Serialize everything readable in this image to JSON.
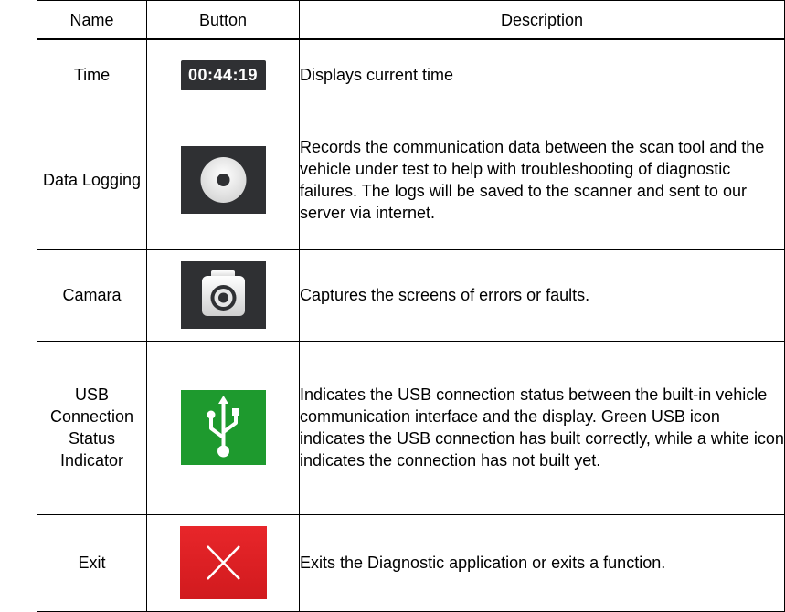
{
  "headers": {
    "name": "Name",
    "button": "Button",
    "description": "Description"
  },
  "rows": [
    {
      "name": "Time",
      "button_text": "00:44:19",
      "icon": "clock-display-icon",
      "description": "Displays current time"
    },
    {
      "name": "Data Logging",
      "icon": "record-icon",
      "description": "Records the communication data between the scan tool and the vehicle under test to help with troubleshooting of diagnostic failures. The logs will be saved to the scanner and sent to our server via internet."
    },
    {
      "name": "Camara",
      "icon": "camera-icon",
      "description": "Captures the screens of errors or faults."
    },
    {
      "name": "USB Connection Status Indicator",
      "icon": "usb-icon",
      "description": "Indicates the USB connection status between the built-in vehicle communication interface and the display. Green USB icon indicates the USB connection has built correctly, while a white icon indicates the connection has not built yet."
    },
    {
      "name": "Exit",
      "icon": "exit-x-icon",
      "description": "Exits the Diagnostic application or exits a function."
    }
  ],
  "colors": {
    "dark_button_bg": "#2f3033",
    "usb_green": "#1e9a2e",
    "exit_red": "#e8262a"
  }
}
